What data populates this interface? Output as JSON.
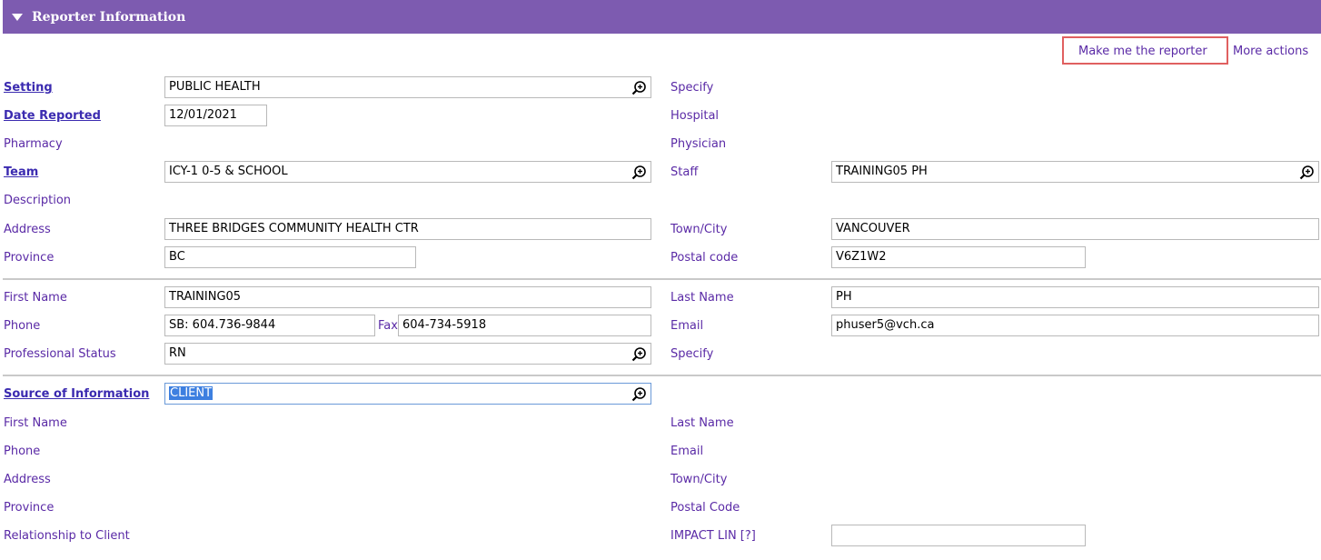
{
  "header": {
    "title": "Reporter Information"
  },
  "actions": {
    "make_me_reporter": "Make me the reporter",
    "more_actions": "More actions"
  },
  "reporter": {
    "setting": {
      "label": "Setting",
      "value": "PUBLIC HEALTH"
    },
    "specify_1": {
      "label": "Specify"
    },
    "date_reported": {
      "label": "Date Reported",
      "value": "12/01/2021"
    },
    "hospital": {
      "label": "Hospital"
    },
    "pharmacy": {
      "label": "Pharmacy"
    },
    "physician": {
      "label": "Physician"
    },
    "team": {
      "label": "Team",
      "value": "ICY-1 0-5 & SCHOOL"
    },
    "staff": {
      "label": "Staff",
      "value": "TRAINING05 PH"
    },
    "description": {
      "label": "Description"
    },
    "address": {
      "label": "Address",
      "value": "THREE BRIDGES COMMUNITY HEALTH CTR"
    },
    "town_city": {
      "label": "Town/City",
      "value": "VANCOUVER"
    },
    "province": {
      "label": "Province",
      "value": "BC"
    },
    "postal_code": {
      "label": "Postal code",
      "value": "V6Z1W2"
    }
  },
  "person": {
    "first_name": {
      "label": "First Name",
      "value": "TRAINING05"
    },
    "last_name": {
      "label": "Last Name",
      "value": "PH"
    },
    "phone": {
      "label": "Phone",
      "value": "SB: 604.736-9844"
    },
    "fax": {
      "label": "Fax",
      "value": "604-734-5918"
    },
    "email": {
      "label": "Email",
      "value": "phuser5@vch.ca"
    },
    "professional_status": {
      "label": "Professional Status",
      "value": "RN"
    },
    "specify_2": {
      "label": "Specify"
    }
  },
  "source": {
    "source_of_info": {
      "label": "Source of Information",
      "value": "CLIENT"
    },
    "first_name": {
      "label": "First Name"
    },
    "last_name": {
      "label": "Last Name"
    },
    "phone": {
      "label": "Phone"
    },
    "email": {
      "label": "Email"
    },
    "address": {
      "label": "Address"
    },
    "town_city": {
      "label": "Town/City"
    },
    "province": {
      "label": "Province"
    },
    "postal_code": {
      "label": "Postal Code"
    },
    "relationship": {
      "label": "Relationship to Client"
    },
    "impact_lin": {
      "label": "IMPACT LIN [?]",
      "value": ""
    }
  },
  "icons": {
    "lookup": "magnifier-plus-icon",
    "collapse": "triangle-down-icon"
  },
  "colors": {
    "header_bg": "#7d5bb0",
    "label": "#5a2aa6",
    "required_label": "#3b2bb0",
    "highlight": "#e06060",
    "selection": "#3d7fe0"
  }
}
